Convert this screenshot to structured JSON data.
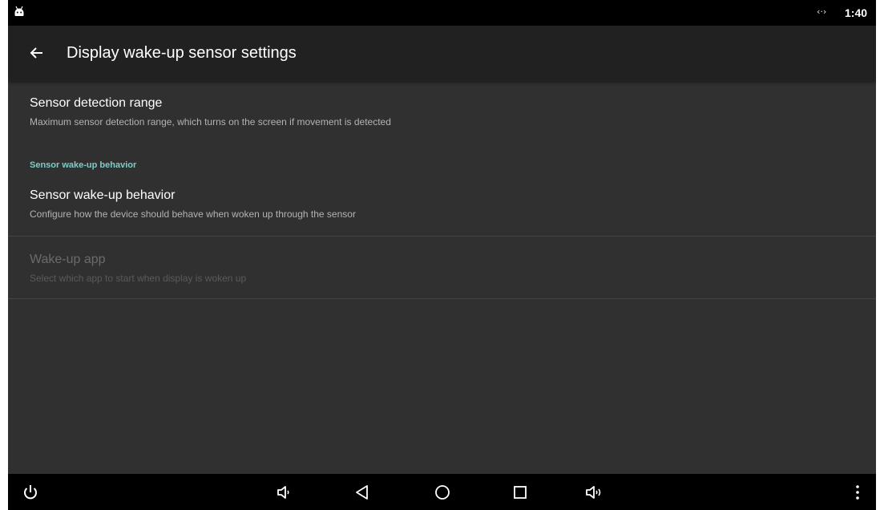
{
  "status_bar": {
    "app_icon": "android-robot-icon",
    "link_icon": "‹·›",
    "time": "1:40"
  },
  "app_bar": {
    "back_icon": "arrow-back-icon",
    "title": "Display wake-up sensor settings"
  },
  "preferences": [
    {
      "title": "Sensor detection range",
      "summary": "Maximum sensor detection range, which turns on the screen if movement is detected",
      "enabled": true
    }
  ],
  "category": {
    "label": "Sensor wake-up behavior",
    "color": "#80cbc4",
    "items": [
      {
        "title": "Sensor wake-up behavior",
        "summary": "Configure how the device should behave when woken up through the sensor",
        "enabled": true
      },
      {
        "title": "Wake-up app",
        "summary": "Select which app to start when display is woken up",
        "enabled": false
      }
    ]
  },
  "nav_bar": {
    "buttons": [
      "power-icon",
      "volume-down-icon",
      "back-triangle-icon",
      "home-circle-icon",
      "recents-square-icon",
      "volume-up-icon",
      "overflow-menu-icon"
    ]
  },
  "colors": {
    "background": "#303030",
    "app_bar": "#212121",
    "status_bar": "#000000",
    "accent": "#80cbc4"
  }
}
